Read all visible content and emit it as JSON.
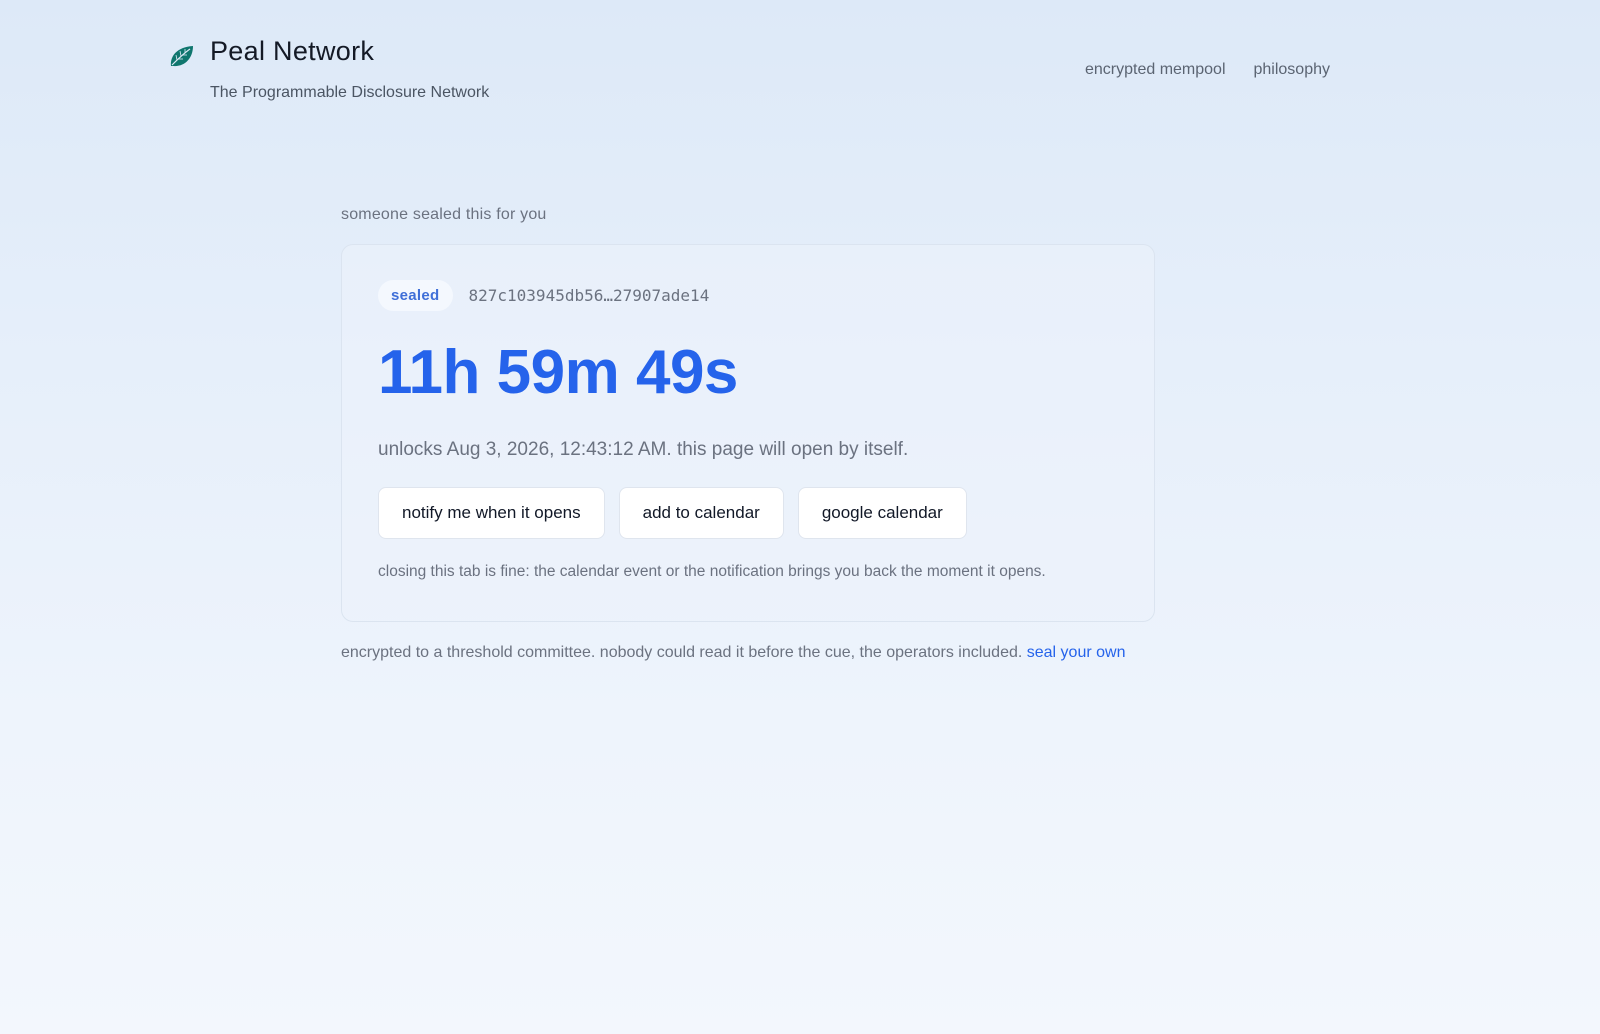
{
  "brand": {
    "title": "Peal Network",
    "subtitle": "The Programmable Disclosure Network",
    "logo_icon": "leaf-icon",
    "logo_color": "#0f766e"
  },
  "nav": {
    "items": [
      {
        "label": "encrypted mempool"
      },
      {
        "label": "philosophy"
      }
    ]
  },
  "main": {
    "intro": "someone sealed this for you",
    "card": {
      "badge": "sealed",
      "hash": "827c103945db56…27907ade14",
      "countdown": "11h 59m 49s",
      "unlocks_prefix": "unlocks ",
      "unlocks_time": "Aug 3, 2026, 12:43:12 AM",
      "unlocks_suffix": ". this page will open by itself.",
      "buttons": {
        "notify": "notify me when it opens",
        "calendar": "add to calendar",
        "google": "google calendar"
      },
      "note": "closing this tab is fine: the calendar event or the notification brings you back the moment it opens."
    },
    "footer_text": "encrypted to a threshold committee. nobody could read it before the cue, the operators included. ",
    "footer_link": "seal your own"
  },
  "colors": {
    "accent": "#2563eb",
    "badge_text": "#3f6fd8",
    "muted_text": "#6b7280"
  }
}
